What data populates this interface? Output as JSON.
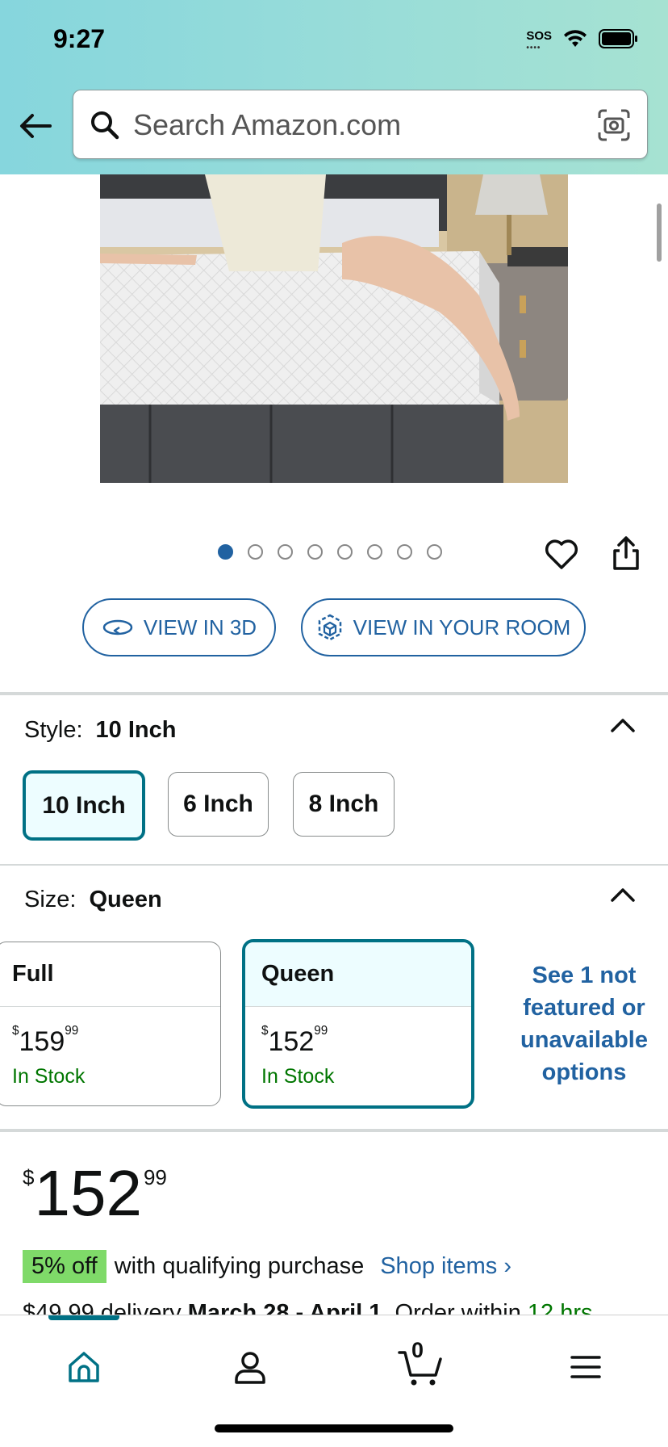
{
  "status_bar": {
    "time": "9:27",
    "sos": "SOS"
  },
  "search": {
    "placeholder": "Search Amazon.com"
  },
  "gallery": {
    "dot_count": 8,
    "active_index": 0
  },
  "buttons": {
    "view_3d": "VIEW IN 3D",
    "view_room": "VIEW IN YOUR ROOM"
  },
  "style": {
    "label": "Style:",
    "selected": "10 Inch",
    "options": [
      "10 Inch",
      "6 Inch",
      "8 Inch"
    ]
  },
  "size": {
    "label": "Size:",
    "selected": "Queen",
    "options": [
      {
        "name": "Full",
        "price_whole": "159",
        "price_fraction": "99",
        "currency": "$",
        "stock": "In Stock"
      },
      {
        "name": "Queen",
        "price_whole": "152",
        "price_fraction": "99",
        "currency": "$",
        "stock": "In Stock"
      }
    ],
    "see_more": "See 1 not featured or unavailable options"
  },
  "price": {
    "currency": "$",
    "whole": "152",
    "fraction": "99"
  },
  "promo": {
    "badge": "5% off",
    "text": "with qualifying purchase",
    "link": "Shop items ›"
  },
  "delivery": {
    "prefix": "$49.99 delivery ",
    "dates": "March 28 - April 1",
    "middle": ". Order within ",
    "time": "12 hrs"
  },
  "cart": {
    "count": "0"
  },
  "colors": {
    "link": "#2162a1",
    "selected_border": "#007185",
    "in_stock": "#007600",
    "badge": "#7fda69"
  }
}
